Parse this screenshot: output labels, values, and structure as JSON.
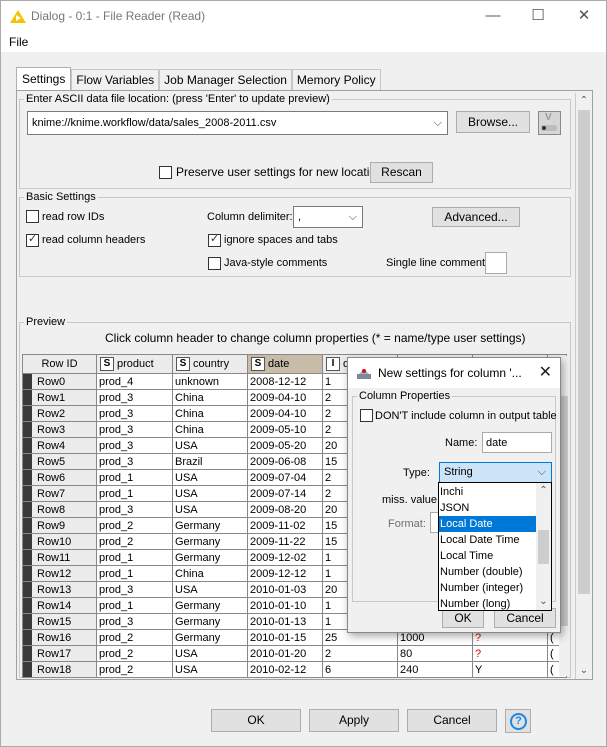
{
  "window": {
    "title": "Dialog - 0:1 - File Reader (Read)",
    "minimize": "—",
    "maximize": "☐",
    "close": "✕"
  },
  "menu": {
    "file": "File"
  },
  "tabs": [
    {
      "label": "Settings",
      "active": true
    },
    {
      "label": "Flow Variables",
      "active": false
    },
    {
      "label": "Job Manager Selection",
      "active": false
    },
    {
      "label": "Memory Policy",
      "active": false
    }
  ],
  "location": {
    "group_label": "Enter ASCII data file location: (press 'Enter' to update preview)",
    "value": "knime://knime.workflow/data/sales_2008-2011.csv",
    "browse": "Browse...",
    "preserve_label": "Preserve user settings for new location",
    "preserve_checked": false,
    "rescan": "Rescan"
  },
  "basic": {
    "group_label": "Basic Settings",
    "read_row_ids": "read row IDs",
    "read_row_ids_checked": false,
    "read_col_headers": "read column headers",
    "read_col_headers_checked": true,
    "delimiter_label": "Column delimiter:",
    "delimiter_value": ",",
    "advanced": "Advanced...",
    "ignore_spaces": "ignore spaces and tabs",
    "ignore_spaces_checked": true,
    "java_comments": "Java-style comments",
    "java_comments_checked": false,
    "single_line_label": "Single line comment:",
    "single_line_value": ""
  },
  "preview": {
    "group_label": "Preview",
    "hint": "Click column header to change column properties (* = name/type user settings)",
    "columns": [
      {
        "label": "Row ID",
        "type": ""
      },
      {
        "label": "product",
        "type": "S"
      },
      {
        "label": "country",
        "type": "S"
      },
      {
        "label": "date",
        "type": "S"
      },
      {
        "label": "quantity",
        "type": "I"
      },
      {
        "label": "",
        "type": ""
      },
      {
        "label": "",
        "type": ""
      },
      {
        "label": "",
        "type": ""
      }
    ],
    "rows": [
      [
        "Row0",
        "prod_4",
        "unknown",
        "2008-12-12",
        "1",
        "",
        "",
        ""
      ],
      [
        "Row1",
        "prod_3",
        "China",
        "2009-04-10",
        "2",
        "",
        "",
        ""
      ],
      [
        "Row2",
        "prod_3",
        "China",
        "2009-04-10",
        "2",
        "",
        "",
        ""
      ],
      [
        "Row3",
        "prod_3",
        "China",
        "2009-05-10",
        "2",
        "",
        "",
        ""
      ],
      [
        "Row4",
        "prod_3",
        "USA",
        "2009-05-20",
        "20",
        "",
        "",
        ""
      ],
      [
        "Row5",
        "prod_3",
        "Brazil",
        "2009-06-08",
        "15",
        "",
        "",
        ""
      ],
      [
        "Row6",
        "prod_1",
        "USA",
        "2009-07-04",
        "2",
        "",
        "",
        ""
      ],
      [
        "Row7",
        "prod_1",
        "USA",
        "2009-07-14",
        "2",
        "",
        "",
        ""
      ],
      [
        "Row8",
        "prod_3",
        "USA",
        "2009-08-20",
        "20",
        "",
        "",
        ""
      ],
      [
        "Row9",
        "prod_2",
        "Germany",
        "2009-11-02",
        "15",
        "",
        "",
        ""
      ],
      [
        "Row10",
        "prod_2",
        "Germany",
        "2009-11-22",
        "15",
        "",
        "",
        ""
      ],
      [
        "Row11",
        "prod_1",
        "Germany",
        "2009-12-02",
        "1",
        "",
        "",
        ""
      ],
      [
        "Row12",
        "prod_1",
        "China",
        "2009-12-12",
        "1",
        "",
        "",
        ""
      ],
      [
        "Row13",
        "prod_3",
        "USA",
        "2010-01-03",
        "20",
        "",
        "",
        ""
      ],
      [
        "Row14",
        "prod_1",
        "Germany",
        "2010-01-10",
        "1",
        "",
        "",
        ""
      ],
      [
        "Row15",
        "prod_3",
        "Germany",
        "2010-01-13",
        "1",
        "",
        "",
        ""
      ],
      [
        "Row16",
        "prod_2",
        "Germany",
        "2010-01-15",
        "25",
        "1000",
        "?",
        "("
      ],
      [
        "Row17",
        "prod_2",
        "USA",
        "2010-01-20",
        "2",
        "80",
        "?",
        "("
      ],
      [
        "Row18",
        "prod_2",
        "USA",
        "2010-02-12",
        "6",
        "240",
        "Y",
        "("
      ]
    ]
  },
  "column_dialog": {
    "title": "New settings for column '...",
    "group_label": "Column Properties",
    "dont_include": "DON'T include column in output table",
    "dont_include_checked": false,
    "name_label": "Name:",
    "name_value": "date",
    "type_label": "Type:",
    "type_value": "String",
    "miss_label": "miss. value",
    "format_label": "Format:",
    "ok": "OK",
    "cancel": "Cancel",
    "type_options": [
      "Inchi",
      "JSON",
      "Local Date",
      "Local Date Time",
      "Local Time",
      "Number (double)",
      "Number (integer)",
      "Number (long)"
    ],
    "type_selected": "Local Date"
  },
  "footer": {
    "ok": "OK",
    "apply": "Apply",
    "cancel": "Cancel",
    "help": "?"
  },
  "colors": {
    "selected_header": "#c8bca9",
    "selection": "#0078d7",
    "missing_value": "#e00000",
    "title_icon": "#f5c400"
  }
}
